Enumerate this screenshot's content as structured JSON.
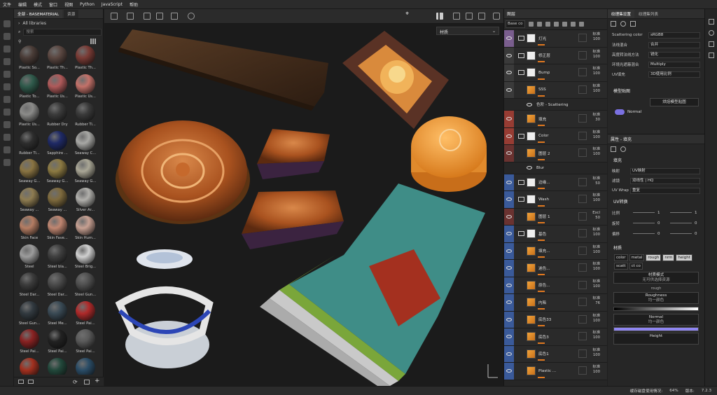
{
  "menu": [
    "文件",
    "编辑",
    "模式",
    "窗口",
    "视图",
    "Python",
    "JavaScript",
    "帮助"
  ],
  "shelf": {
    "tab1": "全部 - BASEMATERIAL",
    "tab2": "资源",
    "path": "All libraries",
    "search_placeholder": "搜索",
    "materials": [
      {
        "label": "Plastic So...",
        "color": "#4a3c37"
      },
      {
        "label": "Plastic Th...",
        "color": "#5b4741"
      },
      {
        "label": "Plastic Th...",
        "color": "#7a3b35"
      },
      {
        "label": "Plastic To...",
        "color": "#2f5a4b"
      },
      {
        "label": "Plastic Us...",
        "color": "#b05a5a"
      },
      {
        "label": "Plastic Us...",
        "color": "#c37169"
      },
      {
        "label": "Plastic Us...",
        "color": "#8b8b89"
      },
      {
        "label": "Rubber Dry",
        "color": "#3b3b3b"
      },
      {
        "label": "Rubber Ti...",
        "color": "#3a3a3a"
      },
      {
        "label": "Rubber Ti...",
        "color": "#2e2e2e"
      },
      {
        "label": "Sapphire ...",
        "color": "#1f2a66"
      },
      {
        "label": "Seaway C...",
        "color": "#a8a8a5"
      },
      {
        "label": "Seaway G...",
        "color": "#8a7442"
      },
      {
        "label": "Seaway G...",
        "color": "#8c7a42"
      },
      {
        "label": "Seaway G...",
        "color": "#aaa796"
      },
      {
        "label": "Seaway ...",
        "color": "#8e7c51"
      },
      {
        "label": "Seaway ...",
        "color": "#7e6a3d"
      },
      {
        "label": "Silver Ar...",
        "color": "#b1b0ac"
      },
      {
        "label": "Skin Face",
        "color": "#b57d63"
      },
      {
        "label": "Skin Fave...",
        "color": "#c08671"
      },
      {
        "label": "Skin Hum...",
        "color": "#c7a092"
      },
      {
        "label": "Steel",
        "color": "#9c9c9c"
      },
      {
        "label": "Steel bla...",
        "color": "#3f3f3f"
      },
      {
        "label": "Steel Brig...",
        "color": "#d0d0d0"
      },
      {
        "label": "Steel Dar...",
        "color": "#3c3c3c"
      },
      {
        "label": "Steel Dar...",
        "color": "#4b4b4b"
      },
      {
        "label": "Steel Gun...",
        "color": "#505050"
      },
      {
        "label": "Steel Gun...",
        "color": "#323a40"
      },
      {
        "label": "Steel Me...",
        "color": "#3a4a55"
      },
      {
        "label": "Steel Pai...",
        "color": "#b02a2a"
      },
      {
        "label": "Steel Pai...",
        "color": "#8a2222"
      },
      {
        "label": "Steel Pai...",
        "color": "#222"
      },
      {
        "label": "Steel Pai...",
        "color": "#5a5a5a"
      },
      {
        "label": "",
        "color": "#a2301f"
      },
      {
        "label": "",
        "color": "#22483b"
      },
      {
        "label": "",
        "color": "#2a4c66"
      }
    ]
  },
  "viewport": {
    "display_mode": "材质"
  },
  "layers": {
    "title": "图层",
    "channel": "Base co",
    "rows": [
      {
        "name": "灯光",
        "blend": "标准",
        "opacity": "100",
        "color": "#7a5e8e",
        "kind": "group"
      },
      {
        "name": "修正层",
        "blend": "标准",
        "opacity": "100",
        "color": "#3a3a3a",
        "kind": "group"
      },
      {
        "name": "Bump",
        "blend": "标准",
        "opacity": "100",
        "color": "#3a3a3a",
        "kind": "group"
      },
      {
        "name": "SSS",
        "blend": "标准",
        "opacity": "100",
        "color": "#3a3a3a",
        "kind": "fill"
      },
      {
        "name": "色阶 - Scattering",
        "kind": "sub"
      },
      {
        "name": "填充",
        "blend": "标准",
        "opacity": "30",
        "color": "#973c33",
        "kind": "fill"
      },
      {
        "name": "Color",
        "blend": "标准",
        "opacity": "100",
        "color": "#973c33",
        "kind": "group"
      },
      {
        "name": "图层 2",
        "blend": "标准",
        "opacity": "100",
        "color": "#6a3230",
        "kind": "fill"
      },
      {
        "name": "Blur",
        "kind": "sub"
      },
      {
        "name": "边缘...",
        "blend": "标准",
        "opacity": "50",
        "color": "#3a5a9a",
        "kind": "group"
      },
      {
        "name": "Wash",
        "blend": "标准",
        "opacity": "100",
        "color": "#3a5a9a",
        "kind": "group"
      },
      {
        "name": "图层 1",
        "blend": "Excl",
        "opacity": "50",
        "color": "#6a3230",
        "kind": "fill"
      },
      {
        "name": "基色",
        "blend": "标准",
        "opacity": "100",
        "color": "#3a5a9a",
        "kind": "group"
      },
      {
        "name": "填充...",
        "blend": "标准",
        "opacity": "100",
        "color": "#3a5a9a",
        "kind": "fill"
      },
      {
        "name": "迷色...",
        "blend": "标准",
        "opacity": "100",
        "color": "#3a5a9a",
        "kind": "fill"
      },
      {
        "name": "原色...",
        "blend": "标准",
        "opacity": "100",
        "color": "#3a5a9a",
        "kind": "fill"
      },
      {
        "name": "内陷",
        "blend": "标准",
        "opacity": "76",
        "color": "#3a5a9a",
        "kind": "fill"
      },
      {
        "name": "底色33",
        "blend": "标准",
        "opacity": "100",
        "color": "#3a5a9a",
        "kind": "fill"
      },
      {
        "name": "底色3",
        "blend": "标准",
        "opacity": "100",
        "color": "#3a5a9a",
        "kind": "fill"
      },
      {
        "name": "底色1",
        "blend": "标准",
        "opacity": "100",
        "color": "#3a5a9a",
        "kind": "fill"
      },
      {
        "name": "Plastic ...",
        "blend": "标准",
        "opacity": "100",
        "color": "#3a5a9a",
        "kind": "fill"
      }
    ]
  },
  "texset": {
    "tab1": "纹理集设置",
    "tab2": "纹理集列表",
    "rows": [
      {
        "k": "Scattering color",
        "v": "sRGB8"
      },
      {
        "k": "法线混合",
        "v": "合并"
      },
      {
        "k": "高度转法线方法",
        "v": "锐化"
      },
      {
        "k": "环境光遮蔽混合",
        "v": "Multiply"
      },
      {
        "k": "UV填充",
        "v": "3D使用比例"
      }
    ],
    "section": "模型贴图",
    "bake_button": "烘焙模型贴图",
    "normal_label": "Normal"
  },
  "props": {
    "title": "属性 - 填充",
    "section_fill": "填充",
    "rows": [
      {
        "k": "映射",
        "v": "UV映射"
      },
      {
        "k": "滤镜",
        "v": "双线性 | HQ"
      },
      {
        "k": "UV Wrap",
        "v": "重复"
      }
    ],
    "uv_section": "UV转换",
    "sliders": [
      {
        "k": "比例",
        "a": "1",
        "b": "1"
      },
      {
        "k": "旋转",
        "a": "0",
        "b": "0"
      },
      {
        "k": "偏移",
        "a": "0",
        "b": "0"
      }
    ],
    "material_section": "材质",
    "chips": [
      "color",
      "metal",
      "rough",
      "nrm",
      "height",
      "scatt",
      "ct co"
    ],
    "chips_on": [
      "rough",
      "nrm",
      "height"
    ],
    "mode_title": "材质模式",
    "mode_sub": "无可供选择资源",
    "rough_label": "rough",
    "rough_title": "Roughness",
    "rough_sub": "均一颜色",
    "normal_title": "Normal",
    "normal_sub": "均一颜色",
    "height_title": "Height",
    "normal_color": "#8f86f0"
  },
  "status": {
    "cache": "缓存磁盘使用情况:",
    "cache_val": "64%",
    "version_label": "版本:",
    "version": "7.2.3"
  }
}
